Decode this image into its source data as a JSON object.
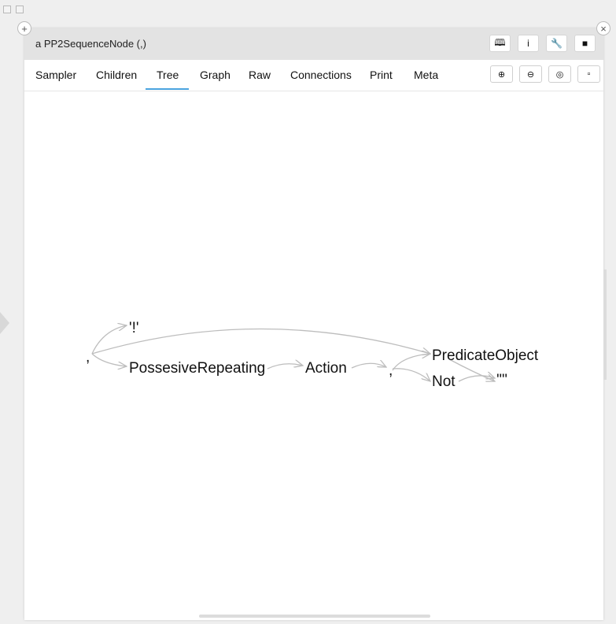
{
  "window": {
    "title": "a PP2SequenceNode (,)"
  },
  "title_buttons": [
    {
      "name": "browse-button",
      "icon": "book-icon",
      "glyph": "🕮"
    },
    {
      "name": "inspect-button",
      "icon": "info-icon",
      "glyph": "i"
    },
    {
      "name": "tools-button",
      "icon": "wrench-icon",
      "glyph": "🔧"
    },
    {
      "name": "maximize-button",
      "icon": "square-icon",
      "glyph": "■"
    }
  ],
  "tabs": [
    {
      "label": "Sampler"
    },
    {
      "label": "Children"
    },
    {
      "label": "Tree",
      "active": true
    },
    {
      "label": "Graph"
    },
    {
      "label": "Raw"
    },
    {
      "label": "Connections"
    },
    {
      "label": "Print"
    },
    {
      "label": "Meta"
    }
  ],
  "zoom_buttons": [
    {
      "name": "zoom-in-button",
      "icon": "zoom-in-icon",
      "glyph": "⊕"
    },
    {
      "name": "zoom-out-button",
      "icon": "zoom-out-icon",
      "glyph": "⊖"
    },
    {
      "name": "zoom-fit-button",
      "icon": "zoom-fit-icon",
      "glyph": "◎"
    },
    {
      "name": "zoom-reset-button",
      "icon": "small-square-icon",
      "glyph": "▫"
    }
  ],
  "tree": {
    "nodes": [
      {
        "id": "root",
        "label": ","
      },
      {
        "id": "bang",
        "label": "'!'"
      },
      {
        "id": "possesive",
        "label": "PossesiveRepeating"
      },
      {
        "id": "action",
        "label": "Action"
      },
      {
        "id": "seq2",
        "label": ","
      },
      {
        "id": "predicate",
        "label": "PredicateObject"
      },
      {
        "id": "not",
        "label": "Not"
      },
      {
        "id": "quote",
        "label": "'\"'"
      }
    ]
  },
  "colors": {
    "accent": "#4aa3df",
    "edge": "#bdbdbd",
    "titlebar": "#e3e3e3"
  }
}
